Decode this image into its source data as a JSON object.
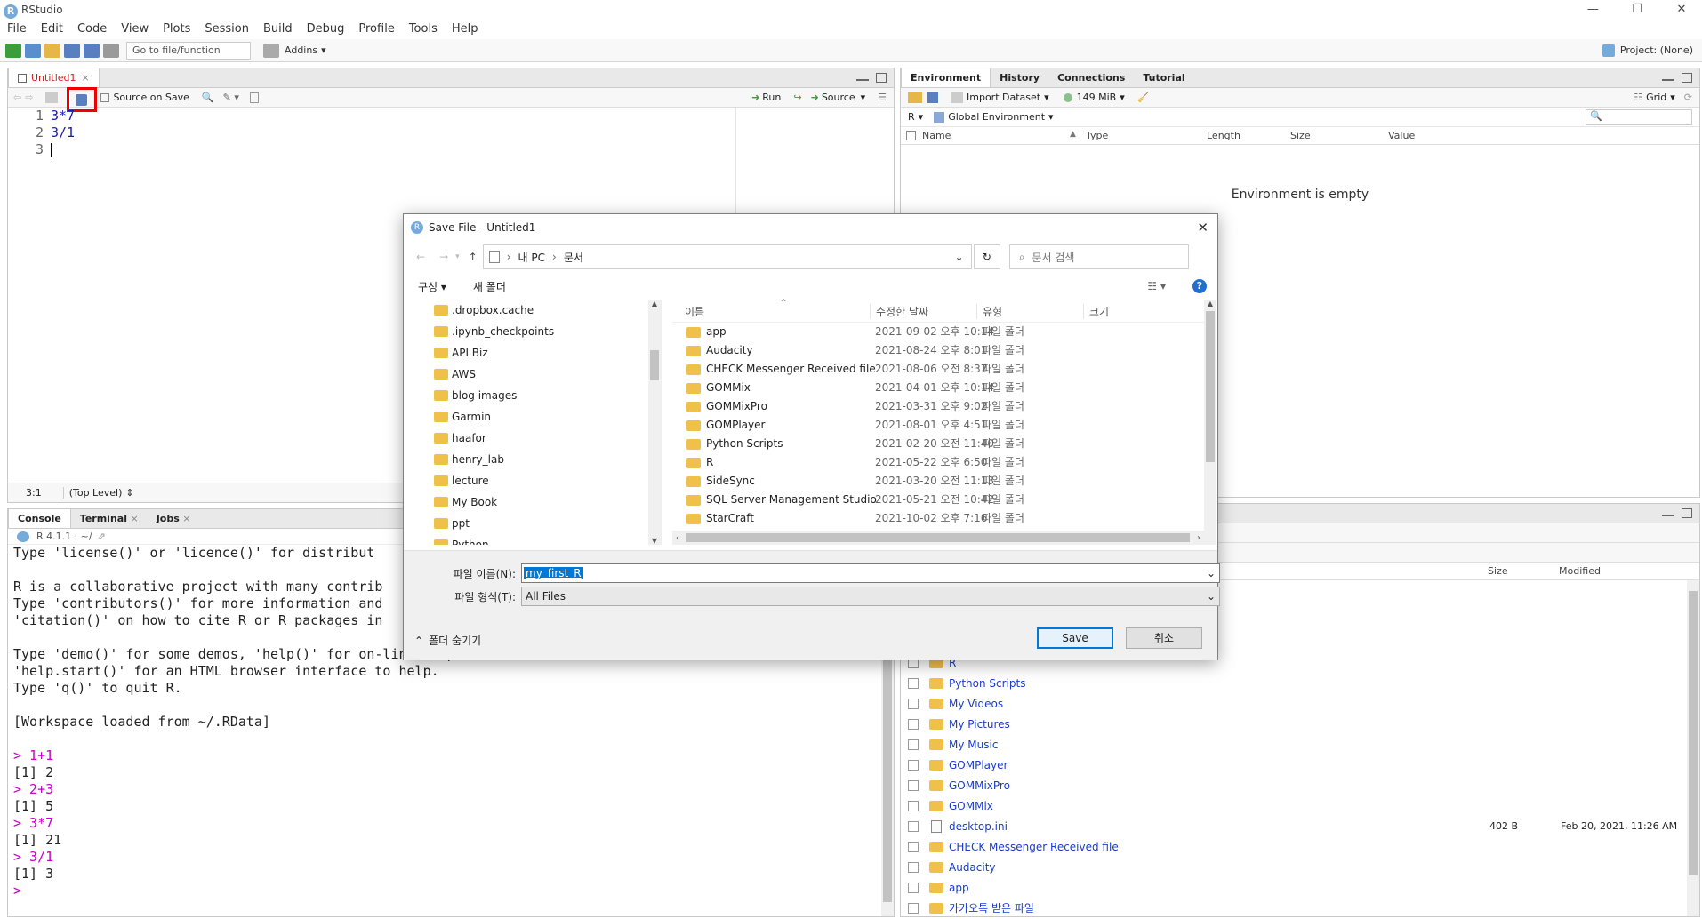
{
  "window": {
    "title": "RStudio",
    "logo": "R"
  },
  "menu": [
    "File",
    "Edit",
    "Code",
    "View",
    "Plots",
    "Session",
    "Build",
    "Debug",
    "Profile",
    "Tools",
    "Help"
  ],
  "toolbar": {
    "goto_placeholder": "Go to file/function",
    "addins": "Addins",
    "project": "Project: (None)"
  },
  "editor": {
    "tab": "Untitled1",
    "source_on_save": "Source on Save",
    "run": "Run",
    "source": "Source",
    "lines": [
      {
        "num": "1",
        "code": "3*7"
      },
      {
        "num": "2",
        "code": "3/1"
      },
      {
        "num": "3",
        "code": ""
      }
    ],
    "status_pos": "3:1",
    "status_scope": "(Top Level)"
  },
  "environment": {
    "tabs": [
      "Environment",
      "History",
      "Connections",
      "Tutorial"
    ],
    "import_dataset": "Import Dataset",
    "memory": "149 MiB",
    "view_mode": "Grid",
    "lang": "R",
    "scope": "Global Environment",
    "columns": [
      "Name",
      "Type",
      "Length",
      "Size",
      "Value"
    ],
    "empty_msg": "Environment is empty"
  },
  "console": {
    "tabs": [
      "Console",
      "Terminal",
      "Jobs"
    ],
    "version": "R 4.1.1 · ~/",
    "lines": [
      {
        "t": "Type 'license()' or 'licence()' for distribut",
        "c": false
      },
      {
        "t": "",
        "c": false
      },
      {
        "t": "R is a collaborative project with many contrib",
        "c": false
      },
      {
        "t": "Type 'contributors()' for more information and",
        "c": false
      },
      {
        "t": "'citation()' on how to cite R or R packages in",
        "c": false
      },
      {
        "t": "",
        "c": false
      },
      {
        "t": "Type 'demo()' for some demos, 'help()' for on-line help, or",
        "c": false
      },
      {
        "t": "'help.start()' for an HTML browser interface to help.",
        "c": false
      },
      {
        "t": "Type 'q()' to quit R.",
        "c": false
      },
      {
        "t": "",
        "c": false
      },
      {
        "t": "[Workspace loaded from ~/.RData]",
        "c": false
      },
      {
        "t": "",
        "c": false
      },
      {
        "t": "> 1+1",
        "c": true
      },
      {
        "t": "[1] 2",
        "c": false
      },
      {
        "t": "> 2+3",
        "c": true
      },
      {
        "t": "[1] 5",
        "c": false
      },
      {
        "t": "> 3*7",
        "c": true
      },
      {
        "t": "[1] 21",
        "c": false
      },
      {
        "t": "> 3/1",
        "c": true
      },
      {
        "t": "[1] 3",
        "c": false
      },
      {
        "t": ">",
        "c": true
      }
    ]
  },
  "files": {
    "columns": {
      "size": "Size",
      "modified": "Modified"
    },
    "rows": [
      {
        "name": "R",
        "folder": true,
        "size": "",
        "modified": ""
      },
      {
        "name": "Python Scripts",
        "folder": true,
        "size": "",
        "modified": ""
      },
      {
        "name": "My Videos",
        "folder": true,
        "size": "",
        "modified": ""
      },
      {
        "name": "My Pictures",
        "folder": true,
        "size": "",
        "modified": ""
      },
      {
        "name": "My Music",
        "folder": true,
        "size": "",
        "modified": ""
      },
      {
        "name": "GOMPlayer",
        "folder": true,
        "size": "",
        "modified": ""
      },
      {
        "name": "GOMMixPro",
        "folder": true,
        "size": "",
        "modified": ""
      },
      {
        "name": "GOMMix",
        "folder": true,
        "size": "",
        "modified": ""
      },
      {
        "name": "desktop.ini",
        "folder": false,
        "size": "402 B",
        "modified": "Feb 20, 2021, 11:26 AM"
      },
      {
        "name": "CHECK Messenger Received file",
        "folder": true,
        "size": "",
        "modified": ""
      },
      {
        "name": "Audacity",
        "folder": true,
        "size": "",
        "modified": ""
      },
      {
        "name": "app",
        "folder": true,
        "size": "",
        "modified": ""
      },
      {
        "name": "카카오톡 받은 파일",
        "folder": true,
        "size": "",
        "modified": ""
      }
    ]
  },
  "dialog": {
    "title": "Save File - Untitled1",
    "path": [
      "내 PC",
      "문서"
    ],
    "search_placeholder": "문서 검색",
    "organize": "구성 ▾",
    "new_folder": "새 폴더",
    "tree": [
      ".dropbox.cache",
      ".ipynb_checkpoints",
      "API Biz",
      "AWS",
      "blog images",
      "Garmin",
      "haafor",
      "henry_lab",
      "lecture",
      "My Book",
      "ppt",
      "Python"
    ],
    "columns": [
      "이름",
      "수정한 날짜",
      "유형",
      "크기"
    ],
    "items": [
      {
        "name": "app",
        "date": "2021-09-02 오후 10:14",
        "type": "파일 폴더"
      },
      {
        "name": "Audacity",
        "date": "2021-08-24 오후 8:01",
        "type": "파일 폴더"
      },
      {
        "name": "CHECK Messenger Received file",
        "date": "2021-08-06 오전 8:37",
        "type": "파일 폴더"
      },
      {
        "name": "GOMMix",
        "date": "2021-04-01 오후 10:14",
        "type": "파일 폴더"
      },
      {
        "name": "GOMMixPro",
        "date": "2021-03-31 오후 9:02",
        "type": "파일 폴더"
      },
      {
        "name": "GOMPlayer",
        "date": "2021-08-01 오후 4:51",
        "type": "파일 폴더"
      },
      {
        "name": "Python Scripts",
        "date": "2021-02-20 오전 11:40",
        "type": "파일 폴더"
      },
      {
        "name": "R",
        "date": "2021-05-22 오후 6:50",
        "type": "파일 폴더"
      },
      {
        "name": "SideSync",
        "date": "2021-03-20 오전 11:13",
        "type": "파일 폴더"
      },
      {
        "name": "SQL Server Management Studio",
        "date": "2021-05-21 오전 10:42",
        "type": "파일 폴더"
      },
      {
        "name": "StarCraft",
        "date": "2021-10-02 오후 7:16",
        "type": "파일 폴더"
      }
    ],
    "filename_label": "파일 이름(N):",
    "filename_value": "my_first_R",
    "filetype_label": "파일 형식(T):",
    "filetype_value": "All Files",
    "hide_folders": "폴더 숨기기",
    "save": "Save",
    "cancel": "취소"
  }
}
